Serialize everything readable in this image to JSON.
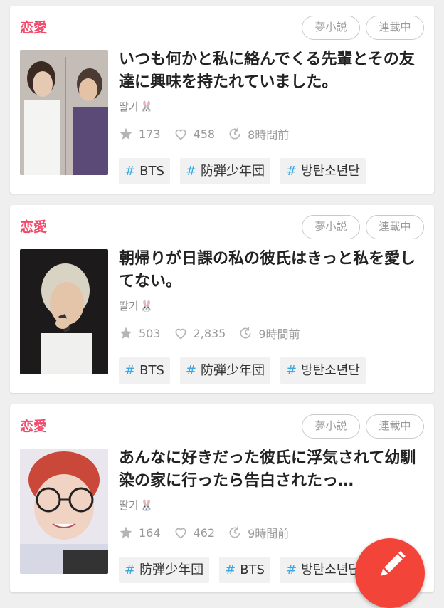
{
  "cards": [
    {
      "category": "恋愛",
      "tags": [
        "夢小説",
        "連載中"
      ],
      "title": "いつも何かと私に絡んでくる先輩とその友達に興味を持たれていました。",
      "author": "딸기",
      "author_emoji": "🐰",
      "stars": "173",
      "likes": "458",
      "updated": "8時間前",
      "hashtags": [
        "BTS",
        "防弾少年団",
        "방탄소년단"
      ]
    },
    {
      "category": "恋愛",
      "tags": [
        "夢小説",
        "連載中"
      ],
      "title": "朝帰りが日課の私の彼氏はきっと私を愛してない。",
      "author": "딸기",
      "author_emoji": "🐰",
      "stars": "503",
      "likes": "2,835",
      "updated": "9時間前",
      "hashtags": [
        "BTS",
        "防弾少年団",
        "방탄소년단"
      ]
    },
    {
      "category": "恋愛",
      "tags": [
        "夢小説",
        "連載中"
      ],
      "title": "あんなに好きだった彼氏に浮気されて幼馴染の家に行ったら告白されたっ…",
      "author": "딸기",
      "author_emoji": "🐰",
      "stars": "164",
      "likes": "462",
      "updated": "9時間前",
      "hashtags": [
        "防弾少年団",
        "BTS",
        "방탄소년단"
      ]
    }
  ],
  "fab": {
    "icon": "pencil-icon"
  },
  "colors": {
    "category": "#f2496b",
    "hash": "#39a8e5",
    "fab": "#f3443a"
  }
}
